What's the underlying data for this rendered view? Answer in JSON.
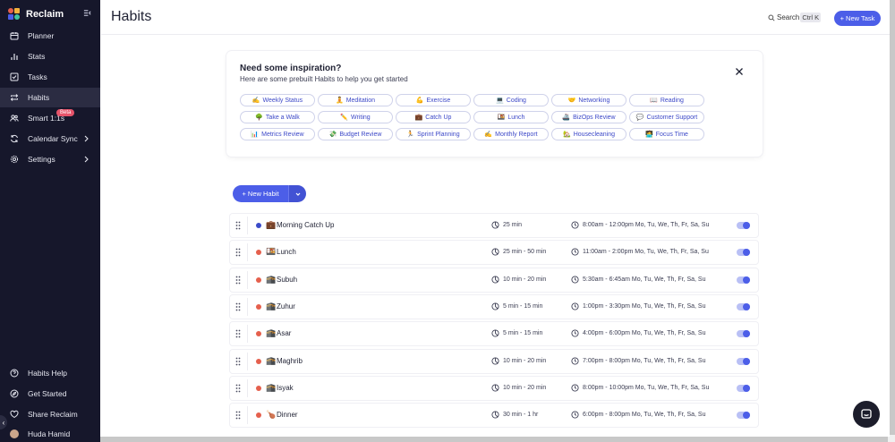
{
  "sidebar": {
    "brand": "Reclaim",
    "items": [
      {
        "label": "Planner"
      },
      {
        "label": "Stats"
      },
      {
        "label": "Tasks"
      },
      {
        "label": "Habits"
      },
      {
        "label": "Smart 1:1s",
        "badge": "Beta"
      },
      {
        "label": "Calendar Sync"
      },
      {
        "label": "Settings"
      }
    ],
    "footer": [
      {
        "label": "Habits Help"
      },
      {
        "label": "Get Started"
      },
      {
        "label": "Share Reclaim"
      },
      {
        "label": "Huda Hamid"
      }
    ]
  },
  "header": {
    "title": "Habits",
    "search_label": "Search",
    "search_shortcut": "Ctrl K",
    "new_task_label": "+ New Task"
  },
  "inspiration": {
    "title": "Need some inspiration?",
    "subtitle": "Here are some prebuilt Habits to help you get started",
    "chips": [
      {
        "emoji": "✍️",
        "label": "Weekly Status"
      },
      {
        "emoji": "🧘",
        "label": "Meditation"
      },
      {
        "emoji": "💪",
        "label": "Exercise"
      },
      {
        "emoji": "💻",
        "label": "Coding"
      },
      {
        "emoji": "🤝",
        "label": "Networking"
      },
      {
        "emoji": "📖",
        "label": "Reading"
      },
      {
        "emoji": "🌳",
        "label": "Take a Walk"
      },
      {
        "emoji": "✏️",
        "label": "Writing"
      },
      {
        "emoji": "💼",
        "label": "Catch Up"
      },
      {
        "emoji": "🍱",
        "label": "Lunch"
      },
      {
        "emoji": "🚢",
        "label": "BizOps Review"
      },
      {
        "emoji": "💬",
        "label": "Customer Support"
      },
      {
        "emoji": "📊",
        "label": "Metrics Review"
      },
      {
        "emoji": "💸",
        "label": "Budget Review"
      },
      {
        "emoji": "🏃",
        "label": "Sprint Planning"
      },
      {
        "emoji": "✍️",
        "label": "Monthly Report"
      },
      {
        "emoji": "🏡",
        "label": "Housecleaning"
      },
      {
        "emoji": "🧑‍💻",
        "label": "Focus Time"
      }
    ]
  },
  "new_habit_label": "+ New Habit",
  "habits": [
    {
      "emoji": "💼",
      "name": "Morning Catch Up",
      "color": "#3b4bc9",
      "duration": "25 min",
      "schedule": "8:00am - 12:00pm Mo, Tu, We, Th, Fr, Sa, Su"
    },
    {
      "emoji": "🍱",
      "name": "Lunch",
      "color": "#e5604d",
      "duration": "25 min - 50 min",
      "schedule": "11:00am - 2:00pm Mo, Tu, We, Th, Fr, Sa, Su"
    },
    {
      "emoji": "🕋",
      "name": "Subuh",
      "color": "#e5604d",
      "duration": "10 min - 20 min",
      "schedule": "5:30am - 6:45am Mo, Tu, We, Th, Fr, Sa, Su"
    },
    {
      "emoji": "🕋",
      "name": "Zuhur",
      "color": "#e5604d",
      "duration": "5 min - 15 min",
      "schedule": "1:00pm - 3:30pm Mo, Tu, We, Th, Fr, Sa, Su"
    },
    {
      "emoji": "🕋",
      "name": "Asar",
      "color": "#e5604d",
      "duration": "5 min - 15 min",
      "schedule": "4:00pm - 6:00pm Mo, Tu, We, Th, Fr, Sa, Su"
    },
    {
      "emoji": "🕋",
      "name": "Maghrib",
      "color": "#e5604d",
      "duration": "10 min - 20 min",
      "schedule": "7:00pm - 8:00pm Mo, Tu, We, Th, Fr, Sa, Su"
    },
    {
      "emoji": "🕋",
      "name": "Isyak",
      "color": "#e5604d",
      "duration": "10 min - 20 min",
      "schedule": "8:00pm - 10:00pm Mo, Tu, We, Th, Fr, Sa, Su"
    },
    {
      "emoji": "🍗",
      "name": "Dinner",
      "color": "#e5604d",
      "duration": "30 min - 1 hr",
      "schedule": "6:00pm - 8:00pm Mo, Tu, We, Th, Fr, Sa, Su"
    }
  ],
  "colors": {
    "accent": "#4c5ee8",
    "sidebar_bg": "#16172b"
  }
}
